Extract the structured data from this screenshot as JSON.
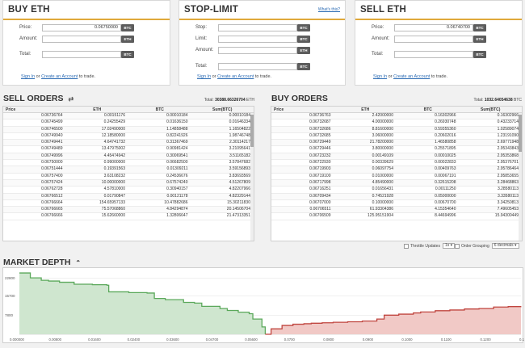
{
  "buy_panel": {
    "title": "BUY ETH",
    "price_label": "Price:",
    "price_value": "0.06750000",
    "price_unit": "BTC",
    "amount_label": "Amount:",
    "amount_value": "",
    "amount_unit": "ETH",
    "total_label": "Total:",
    "total_value": "",
    "total_unit": "BTC",
    "signin": "Sign In",
    "or": "or",
    "create": "Create an Account",
    "to_trade": "to trade."
  },
  "stop_panel": {
    "title": "STOP-LIMIT",
    "whats_this": "What's this?",
    "stop_label": "Stop:",
    "stop_unit": "BTC",
    "limit_label": "Limit:",
    "limit_unit": "BTC",
    "amount_label": "Amount:",
    "amount_unit": "ETH",
    "total_label": "Total:",
    "total_unit": "BTC",
    "signin": "Sign In",
    "or": "or",
    "create": "Create an Account",
    "to_trade": "to trade."
  },
  "sell_panel": {
    "title": "SELL ETH",
    "price_label": "Price:",
    "price_value": "0.06740700",
    "price_unit": "BTC",
    "amount_label": "Amount:",
    "amount_value": "",
    "amount_unit": "ETH",
    "total_label": "Total:",
    "total_value": "",
    "total_unit": "BTC",
    "signin": "Sign In",
    "or": "or",
    "create": "Create an Account",
    "to_trade": "to trade."
  },
  "sell_orders": {
    "title": "SELL ORDERS",
    "total_label": "Total:",
    "total_value": "30388.66326704",
    "total_unit": "ETH",
    "columns": [
      "Price",
      "ETH",
      "BTC",
      "Sum(BTC)"
    ],
    "rows": [
      [
        "0.06736764",
        "0.00151176",
        "0.00010184",
        "0.00010184"
      ],
      [
        "0.06745499",
        "0.24255429",
        "0.01636150",
        "0.01646334"
      ],
      [
        "0.06746500",
        "17.02490000",
        "1.14858488",
        "1.16504822"
      ],
      [
        "0.06749940",
        "12.18580000",
        "0.82241926",
        "1.98746748"
      ],
      [
        "0.06749441",
        "4.64741732",
        "0.31367469",
        "2.30114217"
      ],
      [
        "0.06749489",
        "13.47975002",
        "0.90981424",
        "3.21095641"
      ],
      [
        "0.06749996",
        "4.45474942",
        "0.30069541",
        "3.51165182"
      ],
      [
        "0.06750000",
        "0.99000000",
        "0.06682500",
        "3.57847682"
      ],
      [
        "0.06751444",
        "0.19391563",
        "0.01309211",
        "3.59156893"
      ],
      [
        "0.06757400",
        "3.63108232",
        "0.24536676",
        "3.83693569"
      ],
      [
        "0.06757424",
        "10.00000000",
        "0.67574240",
        "4.51267809"
      ],
      [
        "0.06762728",
        "4.57810000",
        "0.30940157",
        "4.82207966"
      ],
      [
        "0.06766512",
        "0.01790847",
        "0.00121178",
        "4.82329144"
      ],
      [
        "0.06766664",
        "154.65957133",
        "10.47882686",
        "15.30211830"
      ],
      [
        "0.06766665",
        "75.57068860",
        "4.84294874",
        "20.14506704"
      ],
      [
        "0.06766666",
        "15.62660000",
        "1.32806647",
        "21.47313351"
      ]
    ]
  },
  "buy_orders": {
    "title": "BUY ORDERS",
    "total_label": "Total:",
    "total_value": "1032.64054638",
    "total_unit": "BTC",
    "columns": [
      "Price",
      "ETH",
      "BTC",
      "Sum(BTC)"
    ],
    "rows": [
      [
        "0.06736763",
        "2.42000000",
        "0.16302966",
        "0.16302966"
      ],
      [
        "0.06732687",
        "4.00000000",
        "0.26930748",
        "0.43233714"
      ],
      [
        "0.06732686",
        "8.81600000",
        "0.59355360",
        "1.02589074"
      ],
      [
        "0.06732685",
        "3.06000000",
        "0.20602016",
        "1.23191090"
      ],
      [
        "0.06729449",
        "21.78200000",
        "1.46580858",
        "2.69771948"
      ],
      [
        "0.06729446",
        "3.80000000",
        "0.25571895",
        "2.95343843"
      ],
      [
        "0.06723232",
        "0.00149109",
        "0.00010025",
        "2.95353868"
      ],
      [
        "0.06722930",
        "0.00339629",
        "0.00022833",
        "2.95376701"
      ],
      [
        "0.06719903",
        "0.06097754",
        "0.00409763",
        "2.95786464"
      ],
      [
        "0.06719100",
        "0.01000000",
        "0.00067191",
        "2.95853655"
      ],
      [
        "0.06717998",
        "4.85490000",
        "0.32615208",
        "3.28468863"
      ],
      [
        "0.06716251",
        "0.01656431",
        "0.00111250",
        "3.28580113"
      ],
      [
        "0.06709434",
        "0.74521928",
        "0.05000000",
        "3.33580113"
      ],
      [
        "0.06707000",
        "0.10000000",
        "0.00670700",
        "3.34250813"
      ],
      [
        "0.06706511",
        "61.93304386",
        "4.15354640",
        "7.49605453"
      ],
      [
        "0.06706509",
        "125.95151904",
        "8.44694996",
        "15.94300449"
      ]
    ]
  },
  "options": {
    "throttle_label": "Throttle Updates",
    "throttle_value": "1s ▾",
    "grouping_label": "Order Grouping",
    "grouping_value": "6 decimals ▾"
  },
  "market_depth": {
    "title": "MARKET DEPTH",
    "collapse_icon": "chevron-up-icon",
    "bid_color": "#5aa85a",
    "ask_color": "#c0453f"
  },
  "chart_data": {
    "type": "area",
    "title": "MARKET DEPTH",
    "xlabel": "",
    "ylabel": "",
    "xlim": [
      0.0,
      0.1375
    ],
    "ylim": [
      0,
      26000
    ],
    "ytick_labels": [
      "22800",
      "15700",
      "7800"
    ],
    "xtick_labels": [
      "0.000000",
      "0.00800",
      "0.01600",
      "0.02400",
      "0.03600",
      "0.04700",
      "0.05600",
      "0.0700",
      "0.0800",
      "0.0900",
      "0.1000",
      "0.1100",
      "0.1200",
      "0.1300"
    ],
    "series": [
      {
        "x": [
          0.0,
          0.003,
          0.006,
          0.008,
          0.011,
          0.015,
          0.02,
          0.024,
          0.0245,
          0.03,
          0.035,
          0.037,
          0.04,
          0.045,
          0.048,
          0.05,
          0.055,
          0.057,
          0.06,
          0.063,
          0.064,
          0.0665,
          0.0674
        ],
        "y": [
          25000,
          23000,
          22000,
          21700,
          21200,
          20400,
          20200,
          20000,
          17300,
          17000,
          16800,
          14600,
          14100,
          13000,
          12700,
          11400,
          10500,
          9700,
          9000,
          8400,
          6200,
          3000,
          0
        ]
      },
      {
        "x": [
          0.0674,
          0.069,
          0.072,
          0.075,
          0.078,
          0.08,
          0.083,
          0.086,
          0.09,
          0.094,
          0.098,
          0.1,
          0.104,
          0.108,
          0.11,
          0.114,
          0.118,
          0.122,
          0.126,
          0.13,
          0.134,
          0.1375
        ],
        "y": [
          0,
          2200,
          3600,
          4100,
          4300,
          4500,
          4700,
          4900,
          5100,
          5400,
          6200,
          7800,
          8200,
          8700,
          9100,
          9600,
          9900,
          10300,
          10500,
          11100,
          11300,
          11400
        ]
      }
    ]
  }
}
